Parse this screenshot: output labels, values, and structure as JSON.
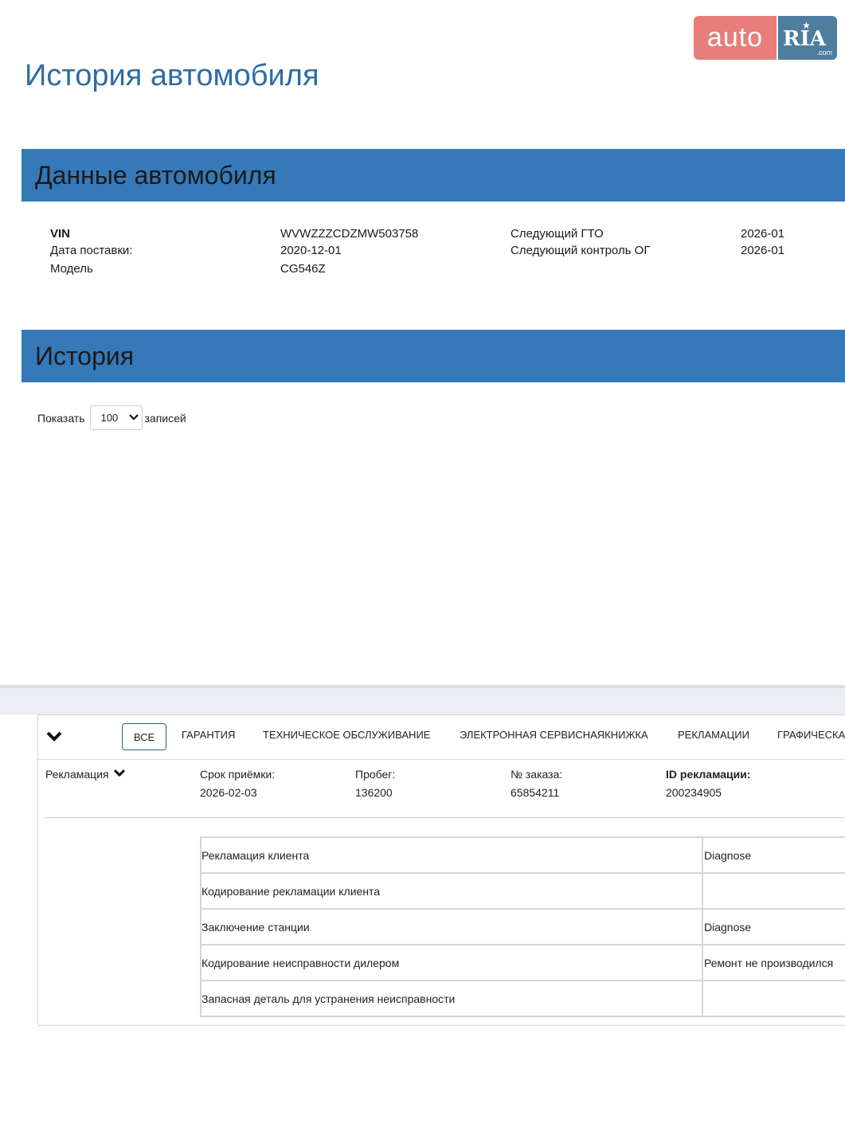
{
  "page_title": "История автомобиля",
  "logo": {
    "auto": "auto",
    "ria": "RIA",
    "com": ".com",
    "colors": {
      "auto_bg": "#e77e7b",
      "ria_bg": "#4d7e9e"
    }
  },
  "vehicle_section": {
    "title": "Данные автомобиля",
    "fields": [
      {
        "label": "VIN",
        "value": "WVWZZZCDZMW503758"
      },
      {
        "label": "Дата поставки:",
        "value": "2020-12-01"
      },
      {
        "label": "Модель",
        "value": "CG546Z"
      }
    ],
    "right_fields": [
      {
        "label": "Следующий ГТО",
        "value": "2026-01"
      },
      {
        "label": "Следующий контроль ОГ",
        "value": "2026-01"
      }
    ]
  },
  "history_section": {
    "title": "История",
    "show_label": "Показать",
    "show_value": "100",
    "records_label": "записей"
  },
  "tabs": {
    "items": [
      {
        "label": "ВСЕ",
        "active": true
      },
      {
        "label": "ГАРАНТИЯ"
      },
      {
        "label": "ТЕХНИЧЕСКОЕ ОБСЛУЖИВАНИЕ"
      },
      {
        "label": "ЭЛЕКТРОННАЯ СЕРВИСНАЯКНИЖКА"
      },
      {
        "label": "РЕКЛАМАЦИИ"
      },
      {
        "label": "ГРАФИЧЕСКА"
      }
    ]
  },
  "claim": {
    "type_label": "Рекламация",
    "date_label": "Срок приёмки:",
    "date_value": "2026-02-03",
    "mileage_label": "Пробег:",
    "mileage_value": "136200",
    "order_label": "№ заказа:",
    "order_value": "65854211",
    "id_label": "ID рекламации:",
    "id_value": "200234905"
  },
  "details": [
    {
      "label": "Рекламация клиента",
      "value": "Diagnose"
    },
    {
      "label": "Кодирование рекламации клиента",
      "value": ""
    },
    {
      "label": "Заключение станции",
      "value": "Diagnose"
    },
    {
      "label": "Кодирование неисправности дилером",
      "value": "Ремонт не производился"
    },
    {
      "label": "Запасная деталь для устранения неисправности",
      "value": ""
    }
  ],
  "colors": {
    "accent": "#3579b8",
    "title": "#2e6da4"
  }
}
